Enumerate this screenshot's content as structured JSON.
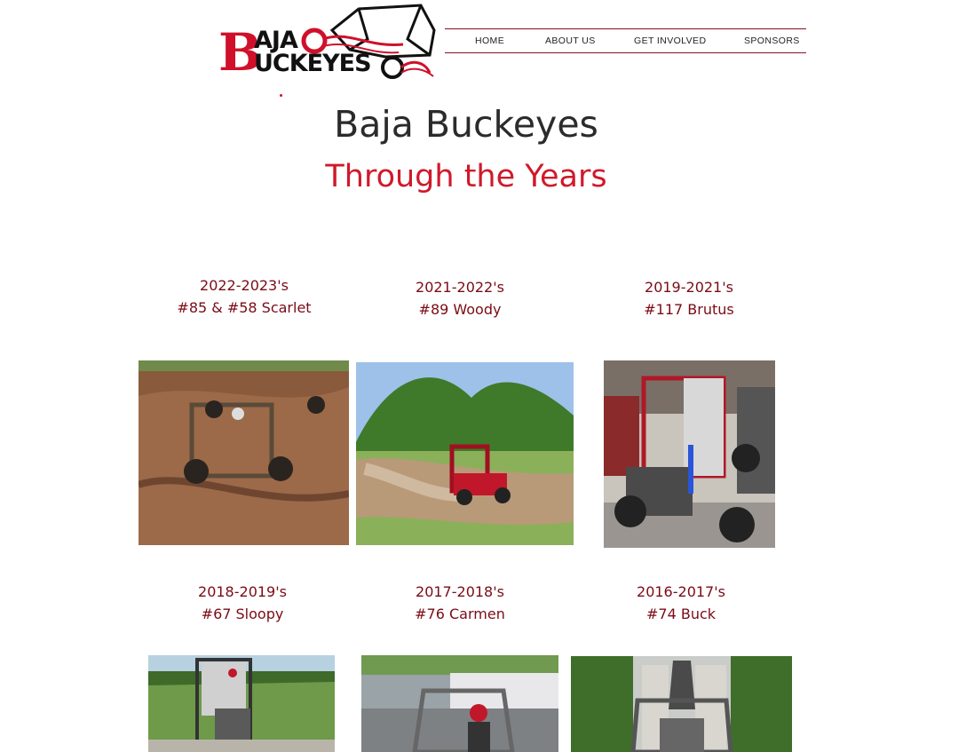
{
  "logo": {
    "line1_initial": "B",
    "line1_rest": "AJA",
    "line2_rest": "UCKEYES"
  },
  "nav": {
    "items": [
      "HOME",
      "ABOUT US",
      "GET INVOLVED",
      "SPONSORS"
    ]
  },
  "heading": {
    "title": "Baja Buckeyes",
    "subtitle": "Through the Years"
  },
  "cars": [
    {
      "years": "2022-2023's",
      "name": "#85 & #58 Scarlet"
    },
    {
      "years": "2021-2022's",
      "name": "#89 Woody"
    },
    {
      "years": "2019-2021's",
      "name": "#117 Brutus"
    },
    {
      "years": "2018-2019's",
      "name": "#67 Sloopy"
    },
    {
      "years": "2017-2018's",
      "name": "#76 Carmen"
    },
    {
      "years": "2016-2017's",
      "name": "#74 Buck"
    }
  ],
  "colors": {
    "accent_red": "#d0192b",
    "caption_red": "#7a0b16",
    "nav_rule": "#8a1020"
  }
}
